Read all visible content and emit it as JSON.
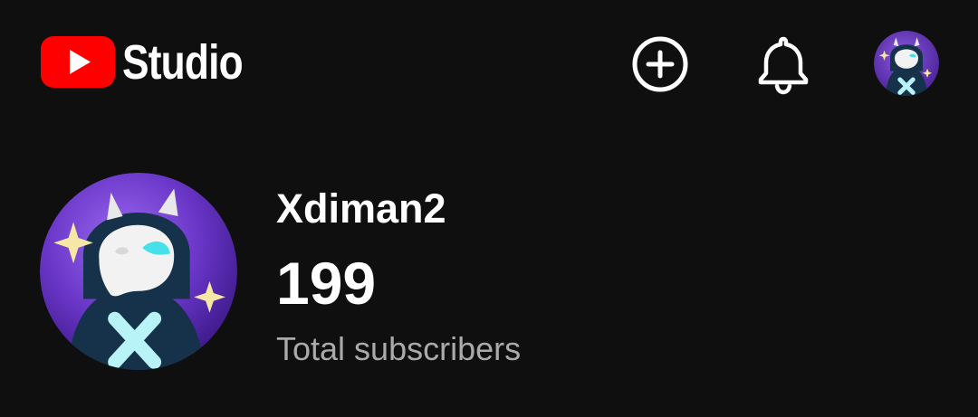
{
  "app": {
    "name": "Studio",
    "logo_icon": "youtube-logo-icon",
    "accent_color": "#ff0000",
    "background_color": "#0f0f0f"
  },
  "header": {
    "actions": [
      {
        "icon": "create-plus-icon"
      },
      {
        "icon": "bell-icon"
      },
      {
        "icon": "account-avatar-icon"
      }
    ]
  },
  "channel": {
    "name": "Xdiman2",
    "subscriber_count": "199",
    "subscriber_label": "Total subscribers",
    "avatar_icon": "channel-avatar-icon"
  }
}
